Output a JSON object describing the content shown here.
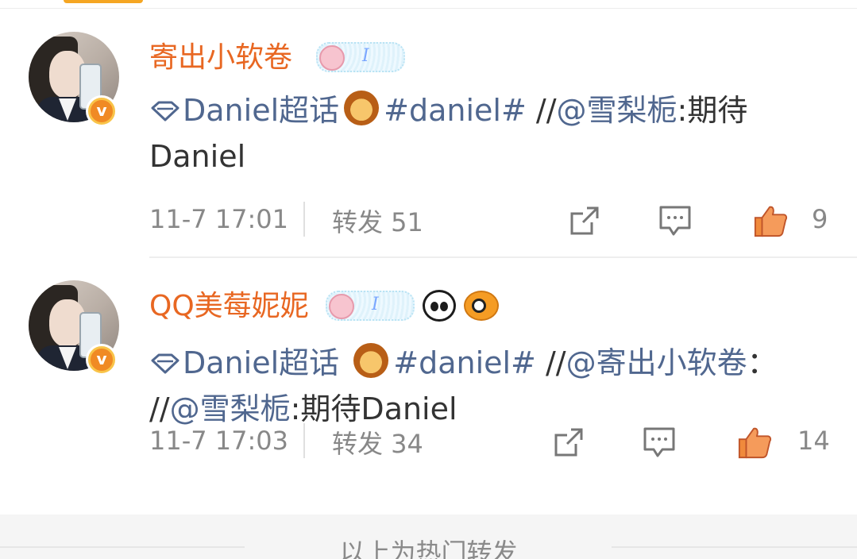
{
  "colors": {
    "username": "#e86722",
    "link": "#50678f",
    "text": "#333333",
    "meta": "#888888",
    "like_active": "#f08a3c"
  },
  "posts": [
    {
      "username": "寄出小软卷",
      "badges": [
        "fan-badge-icon"
      ],
      "content": {
        "super_topic": "Daniel超话",
        "hashtag": "#daniel#",
        "separator": " //",
        "mention": "@雪梨栀",
        "text_after_mention": ":期待Daniel"
      },
      "time": "11-7 17:01",
      "repost_label": "转发 51",
      "like_count": "9",
      "icons": [
        "share-icon",
        "comment-icon",
        "like-icon"
      ]
    },
    {
      "username": "QQ美莓妮妮",
      "badges": [
        "fan-badge-icon",
        "panda-icon",
        "pufferfish-icon"
      ],
      "content": {
        "super_topic": "Daniel超话",
        "hashtag": "#daniel#",
        "separator_1": " //",
        "mention_1": "@寄出小软卷",
        "separator_2": "：  //",
        "mention_2": "@雪梨栀",
        "text_after_mention": ":期待Daniel"
      },
      "time": "11-7 17:03",
      "repost_label": "转发 34",
      "like_count": "14",
      "icons": [
        "share-icon",
        "comment-icon",
        "like-icon"
      ]
    }
  ],
  "footer": {
    "label": "以上为热门转发"
  }
}
